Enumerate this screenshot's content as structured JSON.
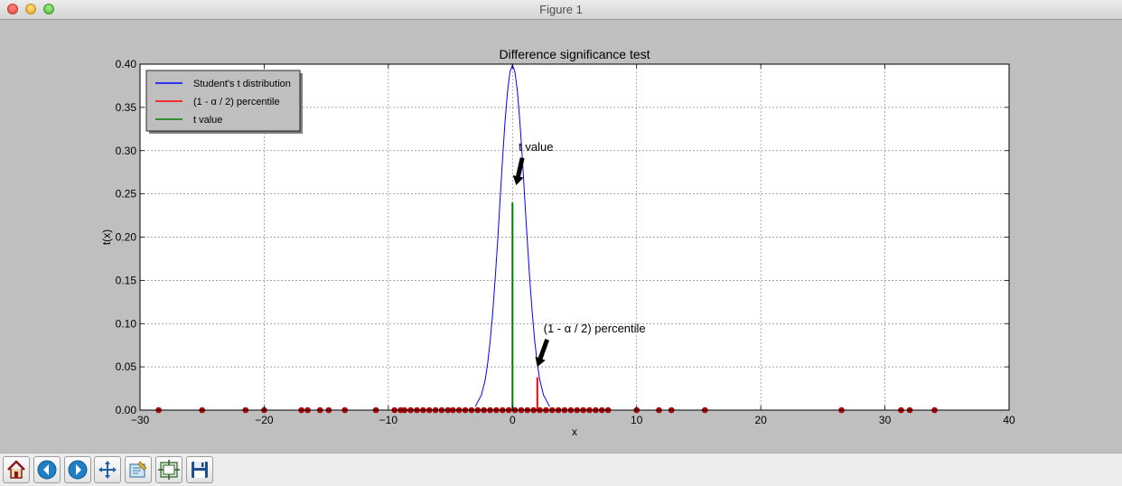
{
  "window": {
    "title": "Figure 1"
  },
  "toolbar": {
    "buttons": [
      {
        "name": "home-button",
        "icon": "home-icon"
      },
      {
        "name": "back-button",
        "icon": "arrow-left-icon"
      },
      {
        "name": "forward-button",
        "icon": "arrow-right-icon"
      },
      {
        "name": "pan-button",
        "icon": "move-icon"
      },
      {
        "name": "zoom-button",
        "icon": "zoom-rect-icon"
      },
      {
        "name": "configure-subplots-button",
        "icon": "subplots-icon"
      },
      {
        "name": "save-button",
        "icon": "floppy-disk-icon"
      }
    ]
  },
  "chart_data": {
    "type": "line",
    "title": "Difference significance test",
    "xlabel": "x",
    "ylabel": "t(x)",
    "xlim": [
      -30,
      40
    ],
    "ylim": [
      0,
      0.4
    ],
    "xticks": [
      -30,
      -20,
      -10,
      0,
      10,
      20,
      30,
      40
    ],
    "xtick_labels": [
      "−30",
      "−20",
      "−10",
      "0",
      "10",
      "20",
      "30",
      "40"
    ],
    "yticks": [
      0,
      0.05,
      0.1,
      0.15,
      0.2,
      0.25,
      0.3,
      0.35,
      0.4
    ],
    "ytick_labels": [
      "0.00",
      "0.05",
      "0.10",
      "0.15",
      "0.20",
      "0.25",
      "0.30",
      "0.35",
      "0.40"
    ],
    "grid": true,
    "legend_position": "top-left",
    "series": [
      {
        "name": "Student's t distribution",
        "color": "#0000ff",
        "x": [
          -3.0,
          -2.5,
          -2.2,
          -2.0,
          -1.8,
          -1.6,
          -1.4,
          -1.2,
          -1.0,
          -0.8,
          -0.6,
          -0.4,
          -0.2,
          0.0,
          0.2,
          0.4,
          0.6,
          0.8,
          1.0,
          1.2,
          1.4,
          1.6,
          1.8,
          2.0,
          2.2,
          2.5,
          3.0
        ],
        "y": [
          0.004,
          0.0175,
          0.035,
          0.054,
          0.079,
          0.111,
          0.15,
          0.194,
          0.242,
          0.29,
          0.333,
          0.368,
          0.391,
          0.399,
          0.391,
          0.368,
          0.333,
          0.29,
          0.242,
          0.194,
          0.15,
          0.111,
          0.079,
          0.054,
          0.035,
          0.0175,
          0.004
        ]
      },
      {
        "name": "(1 - α / 2) percentile",
        "color": "#ff0000",
        "x": [
          2.0,
          2.0
        ],
        "y": [
          0,
          0.038
        ]
      },
      {
        "name": "t value",
        "color": "#008000",
        "x": [
          0.0,
          0.0
        ],
        "y": [
          0,
          0.24
        ]
      }
    ],
    "scatter": {
      "color": "#cc0000",
      "x": [
        -28.5,
        -25,
        -21.5,
        -20,
        -17,
        -16.5,
        -15.5,
        -14.8,
        -13.5,
        -11,
        -9.5,
        -9,
        -8.7,
        -8.2,
        -7.7,
        -7.2,
        -6.7,
        -6.2,
        -5.7,
        -5.2,
        -4.8,
        -4.3,
        -3.8,
        -3.3,
        -2.8,
        -2.3,
        -1.8,
        -1.3,
        -0.8,
        -0.3,
        0.2,
        0.7,
        1.2,
        1.7,
        2.2,
        2.7,
        3.2,
        3.7,
        4.2,
        4.7,
        5.2,
        5.7,
        6.2,
        6.7,
        7.2,
        7.7,
        10,
        11.8,
        12.8,
        15.5,
        26.5,
        31.3,
        32,
        34
      ],
      "y": 0
    },
    "annotations": [
      {
        "text": "t value",
        "xy": [
          0.3,
          0.26
        ],
        "xytext": [
          0.5,
          0.3
        ]
      },
      {
        "text": "(1 - α / 2) percentile",
        "xy": [
          2.0,
          0.05
        ],
        "xytext": [
          2.5,
          0.09
        ]
      }
    ]
  }
}
